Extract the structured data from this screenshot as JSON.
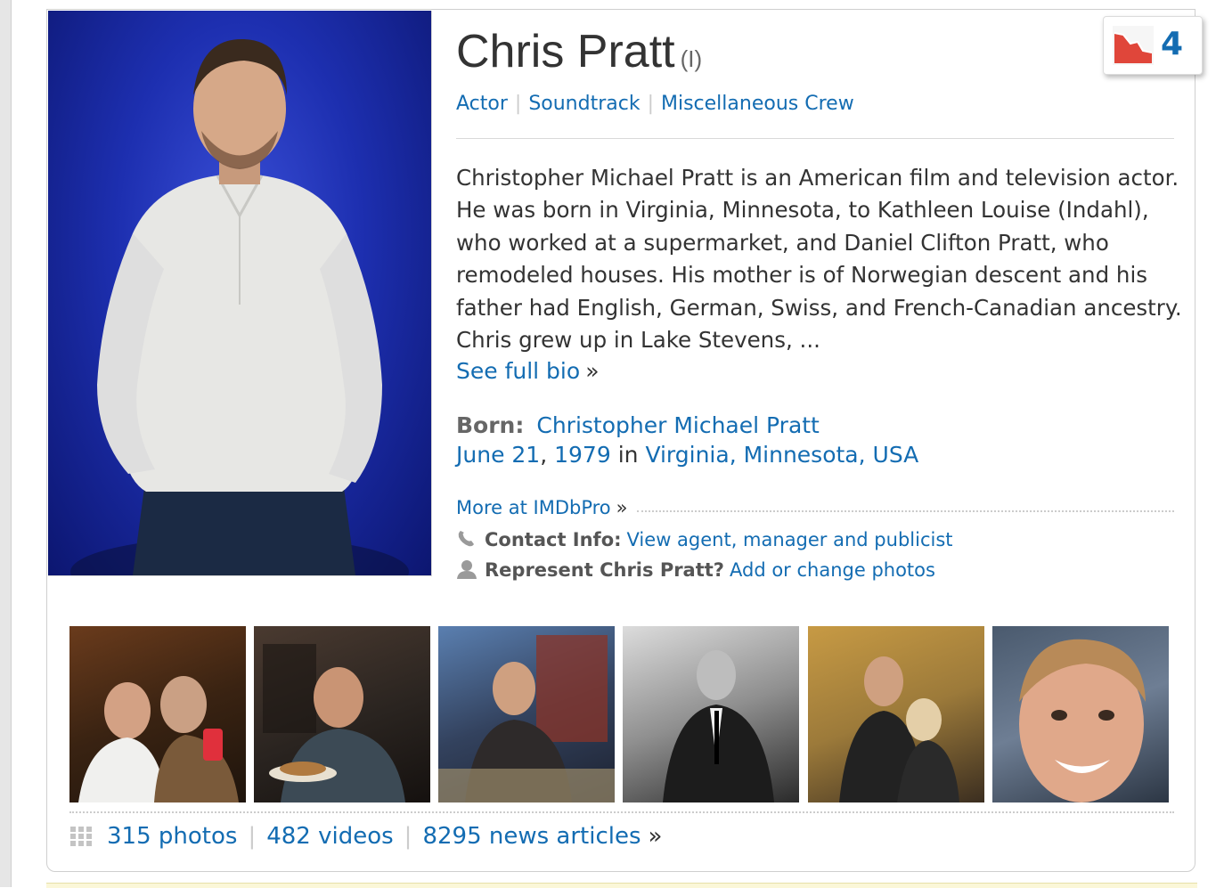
{
  "person": {
    "name": "Chris Pratt",
    "name_suffix": "(I)",
    "jobs": [
      "Actor",
      "Soundtrack",
      "Miscellaneous Crew"
    ],
    "bio": "Christopher Michael Pratt is an American film and television actor. He was born in Virginia, Minnesota, to Kathleen Louise (Indahl), who worked at a supermarket, and Daniel Clifton Pratt, who remodeled houses. His mother is of Norwegian descent and his father had English, German, Swiss, and French-Canadian ancestry. Chris grew up in Lake Stevens, ...",
    "see_full_bio": "See full bio",
    "raquo": "»",
    "born": {
      "label": "Born:",
      "birth_name": "Christopher Michael Pratt",
      "month_day": "June 21",
      "comma": ",",
      "year": "1979",
      "in_text": "in",
      "place": "Virginia, Minnesota, USA"
    }
  },
  "pro": {
    "more_link": "More at IMDbPro",
    "contact_label": "Contact Info:",
    "contact_link": "View agent, manager and publicist",
    "represent_label": "Represent Chris Pratt?",
    "represent_link": "Add or change photos"
  },
  "starmeter": {
    "rank": "4",
    "icon": "starmeter-trend-down-icon"
  },
  "media": {
    "photos": "315 photos",
    "videos": "482 videos",
    "news": "8295 news articles"
  },
  "icons": {
    "phone": "phone-icon",
    "person": "person-icon",
    "grid": "photo-grid-icon"
  },
  "colors": {
    "link": "#136cb2",
    "meter_red": "#e0463a",
    "headshot_bg": "#1d2fb0"
  }
}
